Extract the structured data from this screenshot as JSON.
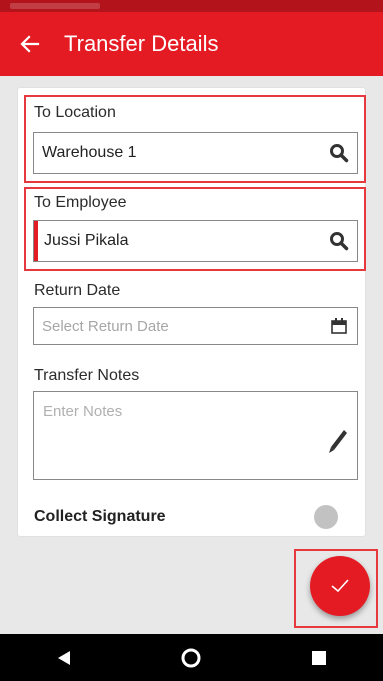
{
  "header": {
    "title": "Transfer Details",
    "back_icon": "arrow-left-icon"
  },
  "form": {
    "to_location": {
      "label": "To Location",
      "value": "Warehouse 1",
      "icon": "search-icon"
    },
    "to_employee": {
      "label": "To Employee",
      "value": "Jussi Pikala",
      "icon": "search-icon"
    },
    "return_date": {
      "label": "Return Date",
      "placeholder": "Select Return Date",
      "icon": "calendar-icon"
    },
    "transfer_notes": {
      "label": "Transfer Notes",
      "placeholder": "Enter Notes",
      "icon": "pencil-icon"
    },
    "collect_signature": {
      "label": "Collect Signature",
      "enabled": false
    }
  },
  "fab": {
    "icon": "check-icon"
  },
  "navbar": {
    "icons": [
      "back-triangle-icon",
      "home-circle-icon",
      "recents-square-icon"
    ]
  },
  "colors": {
    "accent": "#e51b24",
    "highlight": "#e5383f",
    "toggle_off": "#c2c2c2"
  }
}
